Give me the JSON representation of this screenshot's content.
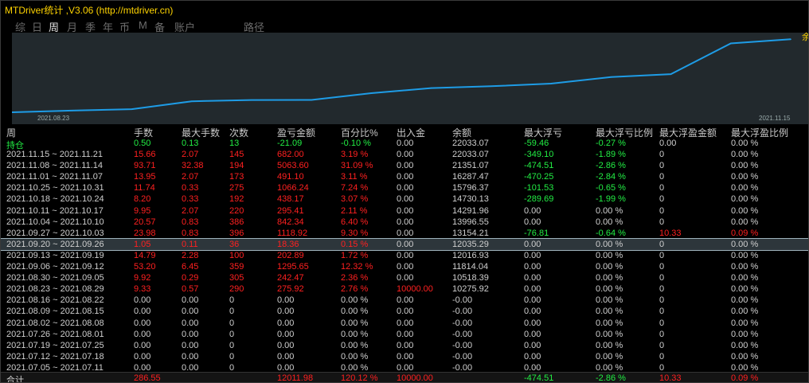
{
  "window": {
    "title": "MTDriver统计 ,V3.06 (http://mtdriver.cn)"
  },
  "tabs": [
    {
      "label": "综",
      "active": false
    },
    {
      "label": "日",
      "active": false
    },
    {
      "label": "周",
      "active": true
    },
    {
      "label": "月",
      "active": false
    },
    {
      "label": "季",
      "active": false
    },
    {
      "label": "年",
      "active": false
    },
    {
      "label": "币",
      "active": false
    },
    {
      "label": "M",
      "active": false
    },
    {
      "label": "备",
      "active": false
    },
    {
      "label": "账户",
      "active": false
    },
    {
      "label": "路径",
      "active": false
    }
  ],
  "chart_data": {
    "type": "line",
    "x_start_label": "2021.08.23",
    "x_end_label": "2021.11.15",
    "edge_glyph": "余",
    "line_color": "#1e9ce6",
    "background": "#22292d",
    "points": [
      {
        "x": 0,
        "y": 10000.0
      },
      {
        "x": 1,
        "y": 10275.92
      },
      {
        "x": 2,
        "y": 10518.39
      },
      {
        "x": 3,
        "y": 11814.04
      },
      {
        "x": 4,
        "y": 12016.93
      },
      {
        "x": 5,
        "y": 12035.29
      },
      {
        "x": 6,
        "y": 13154.21
      },
      {
        "x": 7,
        "y": 13996.55
      },
      {
        "x": 8,
        "y": 14291.96
      },
      {
        "x": 9,
        "y": 14730.13
      },
      {
        "x": 10,
        "y": 15796.37
      },
      {
        "x": 11,
        "y": 16287.47
      },
      {
        "x": 12,
        "y": 21351.07
      },
      {
        "x": 13,
        "y": 22033.07
      }
    ],
    "ylim": [
      10000,
      22600
    ]
  },
  "table": {
    "headers": [
      "周",
      "手数",
      "最大手数",
      "次数",
      "盈亏金额",
      "百分比%",
      "出入金",
      "余额",
      "最大浮亏",
      "最大浮亏比例",
      "最大浮盈金额",
      "最大浮盈比例"
    ],
    "open_row": {
      "cells": [
        "持仓",
        "0.50",
        "0.13",
        "13",
        "-21.09",
        "-0.10 %",
        "0.00",
        "22033.07",
        "-59.46",
        "-0.27 %",
        "0.00",
        "0.00 %"
      ],
      "colors": [
        "g",
        "g",
        "g",
        "g",
        "g",
        "g",
        "w",
        "w",
        "g",
        "g",
        "w",
        "w"
      ]
    },
    "rows": [
      {
        "cells": [
          "2021.11.15 ~ 2021.11.21",
          "15.66",
          "2.07",
          "145",
          "682.00",
          "3.19 %",
          "0.00",
          "22033.07",
          "-349.10",
          "-1.89 %",
          "0",
          "0.00 %"
        ],
        "colors": [
          "w",
          "r",
          "r",
          "r",
          "r",
          "r",
          "w",
          "w",
          "g",
          "g",
          "w",
          "w"
        ]
      },
      {
        "cells": [
          "2021.11.08 ~ 2021.11.14",
          "93.71",
          "32.38",
          "194",
          "5063.60",
          "31.09 %",
          "0.00",
          "21351.07",
          "-474.51",
          "-2.86 %",
          "0",
          "0.00 %"
        ],
        "colors": [
          "w",
          "r",
          "r",
          "r",
          "r",
          "r",
          "w",
          "w",
          "g",
          "g",
          "w",
          "w"
        ]
      },
      {
        "cells": [
          "2021.11.01 ~ 2021.11.07",
          "13.95",
          "2.07",
          "173",
          "491.10",
          "3.11 %",
          "0.00",
          "16287.47",
          "-470.25",
          "-2.84 %",
          "0",
          "0.00 %"
        ],
        "colors": [
          "w",
          "r",
          "r",
          "r",
          "r",
          "r",
          "w",
          "w",
          "g",
          "g",
          "w",
          "w"
        ]
      },
      {
        "cells": [
          "2021.10.25 ~ 2021.10.31",
          "11.74",
          "0.33",
          "275",
          "1066.24",
          "7.24 %",
          "0.00",
          "15796.37",
          "-101.53",
          "-0.65 %",
          "0",
          "0.00 %"
        ],
        "colors": [
          "w",
          "r",
          "r",
          "r",
          "r",
          "r",
          "w",
          "w",
          "g",
          "g",
          "w",
          "w"
        ]
      },
      {
        "cells": [
          "2021.10.18 ~ 2021.10.24",
          "8.20",
          "0.33",
          "192",
          "438.17",
          "3.07 %",
          "0.00",
          "14730.13",
          "-289.69",
          "-1.99 %",
          "0",
          "0.00 %"
        ],
        "colors": [
          "w",
          "r",
          "r",
          "r",
          "r",
          "r",
          "w",
          "w",
          "g",
          "g",
          "w",
          "w"
        ]
      },
      {
        "cells": [
          "2021.10.11 ~ 2021.10.17",
          "9.95",
          "2.07",
          "220",
          "295.41",
          "2.11 %",
          "0.00",
          "14291.96",
          "0.00",
          "0.00 %",
          "0",
          "0.00 %"
        ],
        "colors": [
          "w",
          "r",
          "r",
          "r",
          "r",
          "r",
          "w",
          "w",
          "w",
          "w",
          "w",
          "w"
        ]
      },
      {
        "cells": [
          "2021.10.04 ~ 2021.10.10",
          "20.57",
          "0.83",
          "386",
          "842.34",
          "6.40 %",
          "0.00",
          "13996.55",
          "0.00",
          "0.00 %",
          "0",
          "0.00 %"
        ],
        "colors": [
          "w",
          "r",
          "r",
          "r",
          "r",
          "r",
          "w",
          "w",
          "w",
          "w",
          "w",
          "w"
        ]
      },
      {
        "cells": [
          "2021.09.27 ~ 2021.10.03",
          "23.98",
          "0.83",
          "396",
          "1118.92",
          "9.30 %",
          "0.00",
          "13154.21",
          "-76.81",
          "-0.64 %",
          "10.33",
          "0.09 %"
        ],
        "colors": [
          "w",
          "r",
          "r",
          "r",
          "r",
          "r",
          "w",
          "w",
          "g",
          "g",
          "r",
          "r"
        ]
      },
      {
        "cells": [
          "2021.09.20 ~ 2021.09.26",
          "1.05",
          "0.11",
          "36",
          "18.36",
          "0.15 %",
          "0.00",
          "12035.29",
          "0.00",
          "0.00 %",
          "0",
          "0.00 %"
        ],
        "colors": [
          "w",
          "r",
          "r",
          "r",
          "r",
          "r",
          "w",
          "w",
          "w",
          "w",
          "w",
          "w"
        ],
        "selected": true
      },
      {
        "cells": [
          "2021.09.13 ~ 2021.09.19",
          "14.79",
          "2.28",
          "100",
          "202.89",
          "1.72 %",
          "0.00",
          "12016.93",
          "0.00",
          "0.00 %",
          "0",
          "0.00 %"
        ],
        "colors": [
          "w",
          "r",
          "r",
          "r",
          "r",
          "r",
          "w",
          "w",
          "w",
          "w",
          "w",
          "w"
        ]
      },
      {
        "cells": [
          "2021.09.06 ~ 2021.09.12",
          "53.20",
          "6.45",
          "359",
          "1295.65",
          "12.32 %",
          "0.00",
          "11814.04",
          "0.00",
          "0.00 %",
          "0",
          "0.00 %"
        ],
        "colors": [
          "w",
          "r",
          "r",
          "r",
          "r",
          "r",
          "w",
          "w",
          "w",
          "w",
          "w",
          "w"
        ]
      },
      {
        "cells": [
          "2021.08.30 ~ 2021.09.05",
          "9.92",
          "0.29",
          "305",
          "242.47",
          "2.36 %",
          "0.00",
          "10518.39",
          "0.00",
          "0.00 %",
          "0",
          "0.00 %"
        ],
        "colors": [
          "w",
          "r",
          "r",
          "r",
          "r",
          "r",
          "w",
          "w",
          "w",
          "w",
          "w",
          "w"
        ]
      },
      {
        "cells": [
          "2021.08.23 ~ 2021.08.29",
          "9.33",
          "0.57",
          "290",
          "275.92",
          "2.76 %",
          "10000.00",
          "10275.92",
          "0.00",
          "0.00 %",
          "0",
          "0.00 %"
        ],
        "colors": [
          "w",
          "r",
          "r",
          "r",
          "r",
          "r",
          "r",
          "w",
          "w",
          "w",
          "w",
          "w"
        ]
      },
      {
        "cells": [
          "2021.08.16 ~ 2021.08.22",
          "0.00",
          "0.00",
          "0",
          "0.00",
          "0.00 %",
          "0.00",
          "-0.00",
          "0.00",
          "0.00 %",
          "0",
          "0.00 %"
        ],
        "colors": [
          "w",
          "w",
          "w",
          "w",
          "w",
          "w",
          "w",
          "w",
          "w",
          "w",
          "w",
          "w"
        ]
      },
      {
        "cells": [
          "2021.08.09 ~ 2021.08.15",
          "0.00",
          "0.00",
          "0",
          "0.00",
          "0.00 %",
          "0.00",
          "-0.00",
          "0.00",
          "0.00 %",
          "0",
          "0.00 %"
        ],
        "colors": [
          "w",
          "w",
          "w",
          "w",
          "w",
          "w",
          "w",
          "w",
          "w",
          "w",
          "w",
          "w"
        ]
      },
      {
        "cells": [
          "2021.08.02 ~ 2021.08.08",
          "0.00",
          "0.00",
          "0",
          "0.00",
          "0.00 %",
          "0.00",
          "-0.00",
          "0.00",
          "0.00 %",
          "0",
          "0.00 %"
        ],
        "colors": [
          "w",
          "w",
          "w",
          "w",
          "w",
          "w",
          "w",
          "w",
          "w",
          "w",
          "w",
          "w"
        ]
      },
      {
        "cells": [
          "2021.07.26 ~ 2021.08.01",
          "0.00",
          "0.00",
          "0",
          "0.00",
          "0.00 %",
          "0.00",
          "-0.00",
          "0.00",
          "0.00 %",
          "0",
          "0.00 %"
        ],
        "colors": [
          "w",
          "w",
          "w",
          "w",
          "w",
          "w",
          "w",
          "w",
          "w",
          "w",
          "w",
          "w"
        ]
      },
      {
        "cells": [
          "2021.07.19 ~ 2021.07.25",
          "0.00",
          "0.00",
          "0",
          "0.00",
          "0.00 %",
          "0.00",
          "-0.00",
          "0.00",
          "0.00 %",
          "0",
          "0.00 %"
        ],
        "colors": [
          "w",
          "w",
          "w",
          "w",
          "w",
          "w",
          "w",
          "w",
          "w",
          "w",
          "w",
          "w"
        ]
      },
      {
        "cells": [
          "2021.07.12 ~ 2021.07.18",
          "0.00",
          "0.00",
          "0",
          "0.00",
          "0.00 %",
          "0.00",
          "-0.00",
          "0.00",
          "0.00 %",
          "0",
          "0.00 %"
        ],
        "colors": [
          "w",
          "w",
          "w",
          "w",
          "w",
          "w",
          "w",
          "w",
          "w",
          "w",
          "w",
          "w"
        ]
      },
      {
        "cells": [
          "2021.07.05 ~ 2021.07.11",
          "0.00",
          "0.00",
          "0",
          "0.00",
          "0.00 %",
          "0.00",
          "-0.00",
          "0.00",
          "0.00 %",
          "0",
          "0.00 %"
        ],
        "colors": [
          "w",
          "w",
          "w",
          "w",
          "w",
          "w",
          "w",
          "w",
          "w",
          "w",
          "w",
          "w"
        ]
      }
    ],
    "total_row": {
      "cells": [
        "合计",
        "286.55",
        "",
        "",
        "12011.98",
        "120.12 %",
        "10000.00",
        "",
        "-474.51",
        "-2.86 %",
        "10.33",
        "0.09 %"
      ],
      "colors": [
        "w",
        "r",
        "w",
        "w",
        "r",
        "r",
        "r",
        "w",
        "g",
        "g",
        "r",
        "r"
      ]
    }
  },
  "colors": {
    "red": "#ff2020",
    "green": "#22ee44",
    "white": "#cfcfcf",
    "title": "#ffd400",
    "selected_bg": "#2d363b"
  }
}
